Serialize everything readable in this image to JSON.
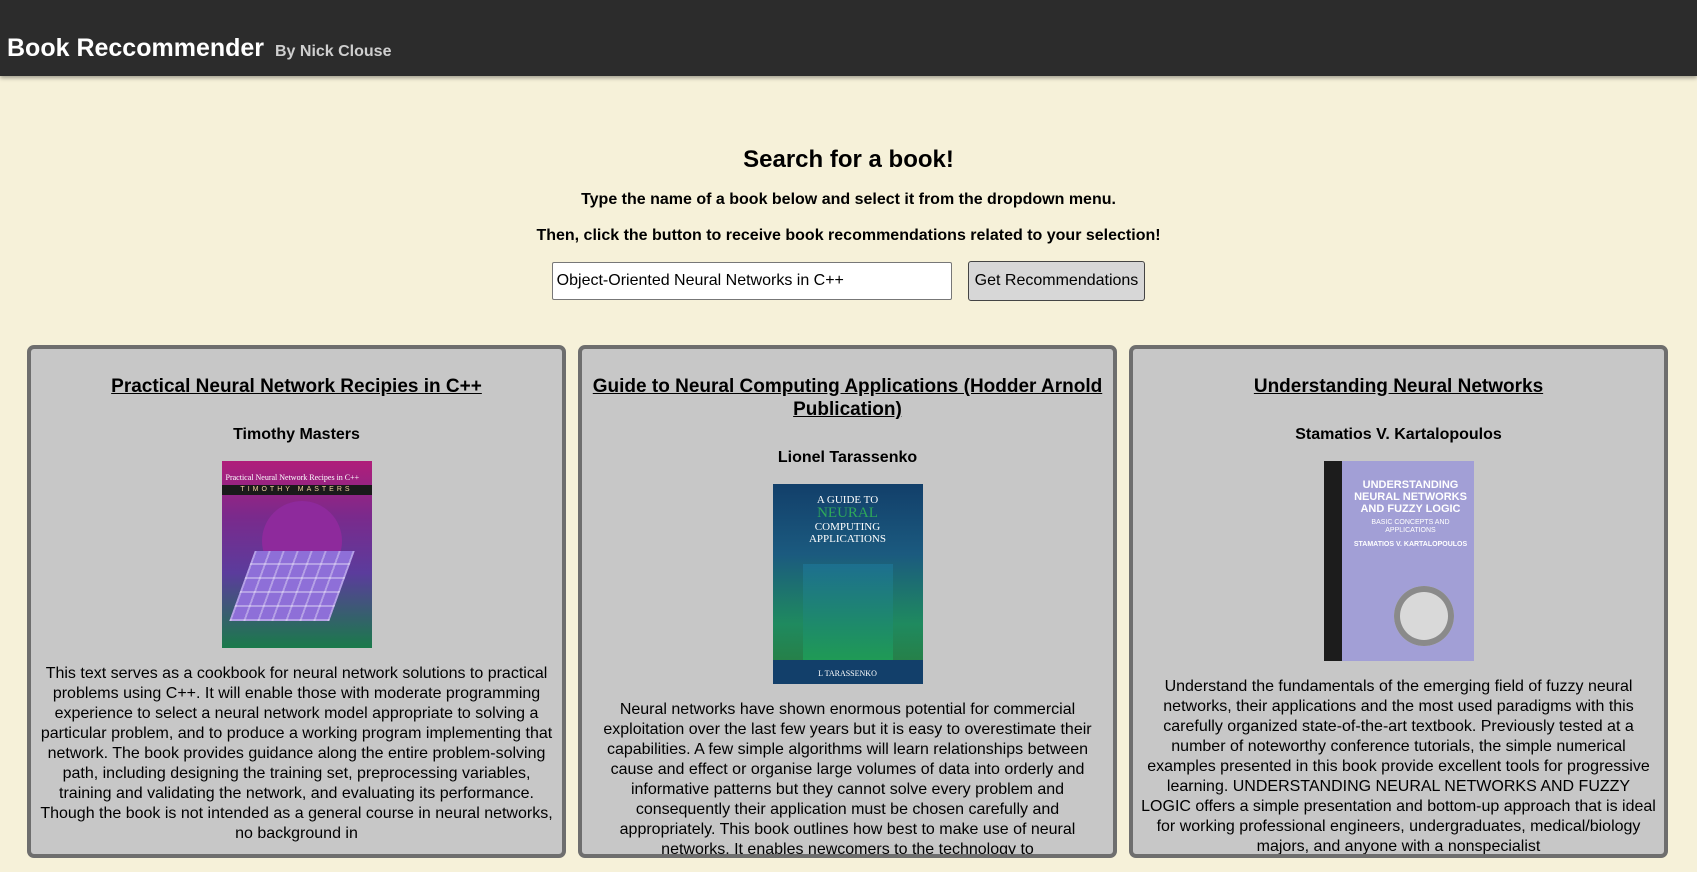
{
  "header": {
    "title": "Book Reccommender",
    "byline": "By Nick Clouse",
    "bg_color": "#2c2c2c"
  },
  "search": {
    "heading": "Search for a book!",
    "instruction_1": "Type the name of a book below and select it from the dropdown menu.",
    "instruction_2": "Then, click the button to receive book recommendations related to your selection!",
    "input_value": "Object-Oriented Neural Networks in C++",
    "button_label": "Get Recommendations"
  },
  "theme": {
    "page_bg": "#f6f1d9",
    "card_bg": "#c7c7c7",
    "card_border": "#6e6e6e"
  },
  "books": [
    {
      "title": "Practical Neural Network Recipies in C++",
      "author": "Timothy Masters",
      "cover_title": "Practical Neural Network Recipes in C++",
      "cover_author": "TIMOTHY MASTERS",
      "description": "This text serves as a cookbook for neural network solutions to practical problems using C++. It will enable those with moderate programming experience to select a neural network model appropriate to solving a particular problem, and to produce a working program implementing that network. The book provides guidance along the entire problem-solving path, including designing the training set, preprocessing variables, training and validating the network, and evaluating its performance. Though the book is not intended as a general course in neural networks, no background in"
    },
    {
      "title": "Guide to Neural Computing Applications (Hodder Arnold Publication)",
      "author": "Lionel Tarassenko",
      "cover_title_1": "A GUIDE TO",
      "cover_title_2": "NEURAL",
      "cover_title_3": "COMPUTING APPLICATIONS",
      "cover_author": "L TARASSENKO",
      "description": "Neural networks have shown enormous potential for commercial exploitation over the last few years but it is easy to overestimate their capabilities. A few simple algorithms will learn relationships between cause and effect or organise large volumes of data into orderly and informative patterns but they cannot solve every problem and consequently their application must be chosen carefully and appropriately. This book outlines how best to make use of neural networks. It enables newcomers to the technology to"
    },
    {
      "title": "Understanding Neural Networks",
      "author": "Stamatios V. Kartalopoulos",
      "cover_title": "UNDERSTANDING NEURAL NETWORKS AND FUZZY LOGIC",
      "cover_subtitle": "BASIC CONCEPTS AND APPLICATIONS",
      "cover_author": "STAMATIOS V. KARTALOPOULOS",
      "description": "Understand the fundamentals of the emerging field of fuzzy neural networks, their applications and the most used paradigms with this carefully organized state-of-the-art textbook. Previously tested at a number of noteworthy conference tutorials, the simple numerical examples presented in this book provide excellent tools for progressive learning. UNDERSTANDING NEURAL NETWORKS AND FUZZY LOGIC offers a simple presentation and bottom-up approach that is ideal for working professional engineers, undergraduates, medical/biology majors, and anyone with a nonspecialist"
    }
  ]
}
